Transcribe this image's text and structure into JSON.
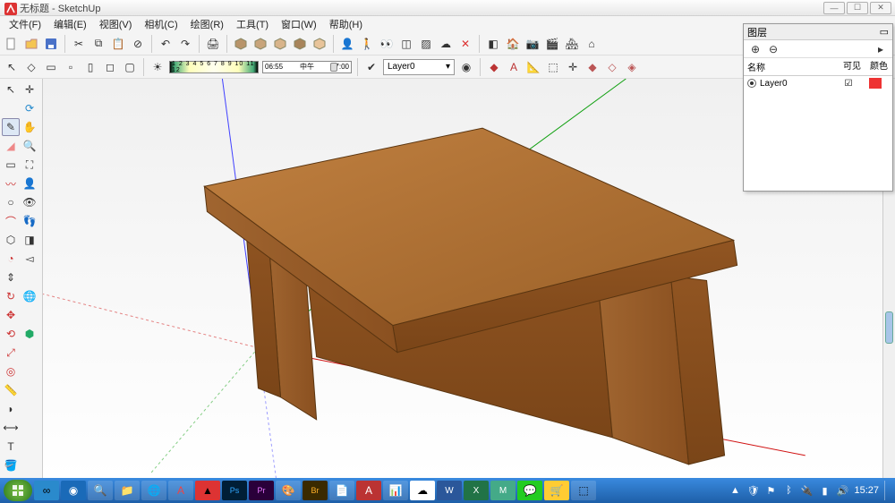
{
  "titlebar": {
    "document": "无标题",
    "app": "SketchUp"
  },
  "menu": [
    "文件(F)",
    "编辑(E)",
    "视图(V)",
    "相机(C)",
    "绘图(R)",
    "工具(T)",
    "窗口(W)",
    "帮助(H)"
  ],
  "toolbar1": {
    "time_numbers": "1 2 3 4 5 6 7 8 9 10 11 12",
    "time_start": "06:55",
    "time_mid": "中午",
    "time_end": "17:00",
    "layer_current": "Layer0"
  },
  "layers_panel": {
    "title": "图层",
    "col_name": "名称",
    "col_visible": "可见",
    "col_color": "颜色",
    "rows": [
      {
        "name": "Layer0",
        "visible": true,
        "active": true,
        "color": "#ee3333"
      }
    ]
  },
  "taskbar": {
    "clock": "15:27"
  }
}
